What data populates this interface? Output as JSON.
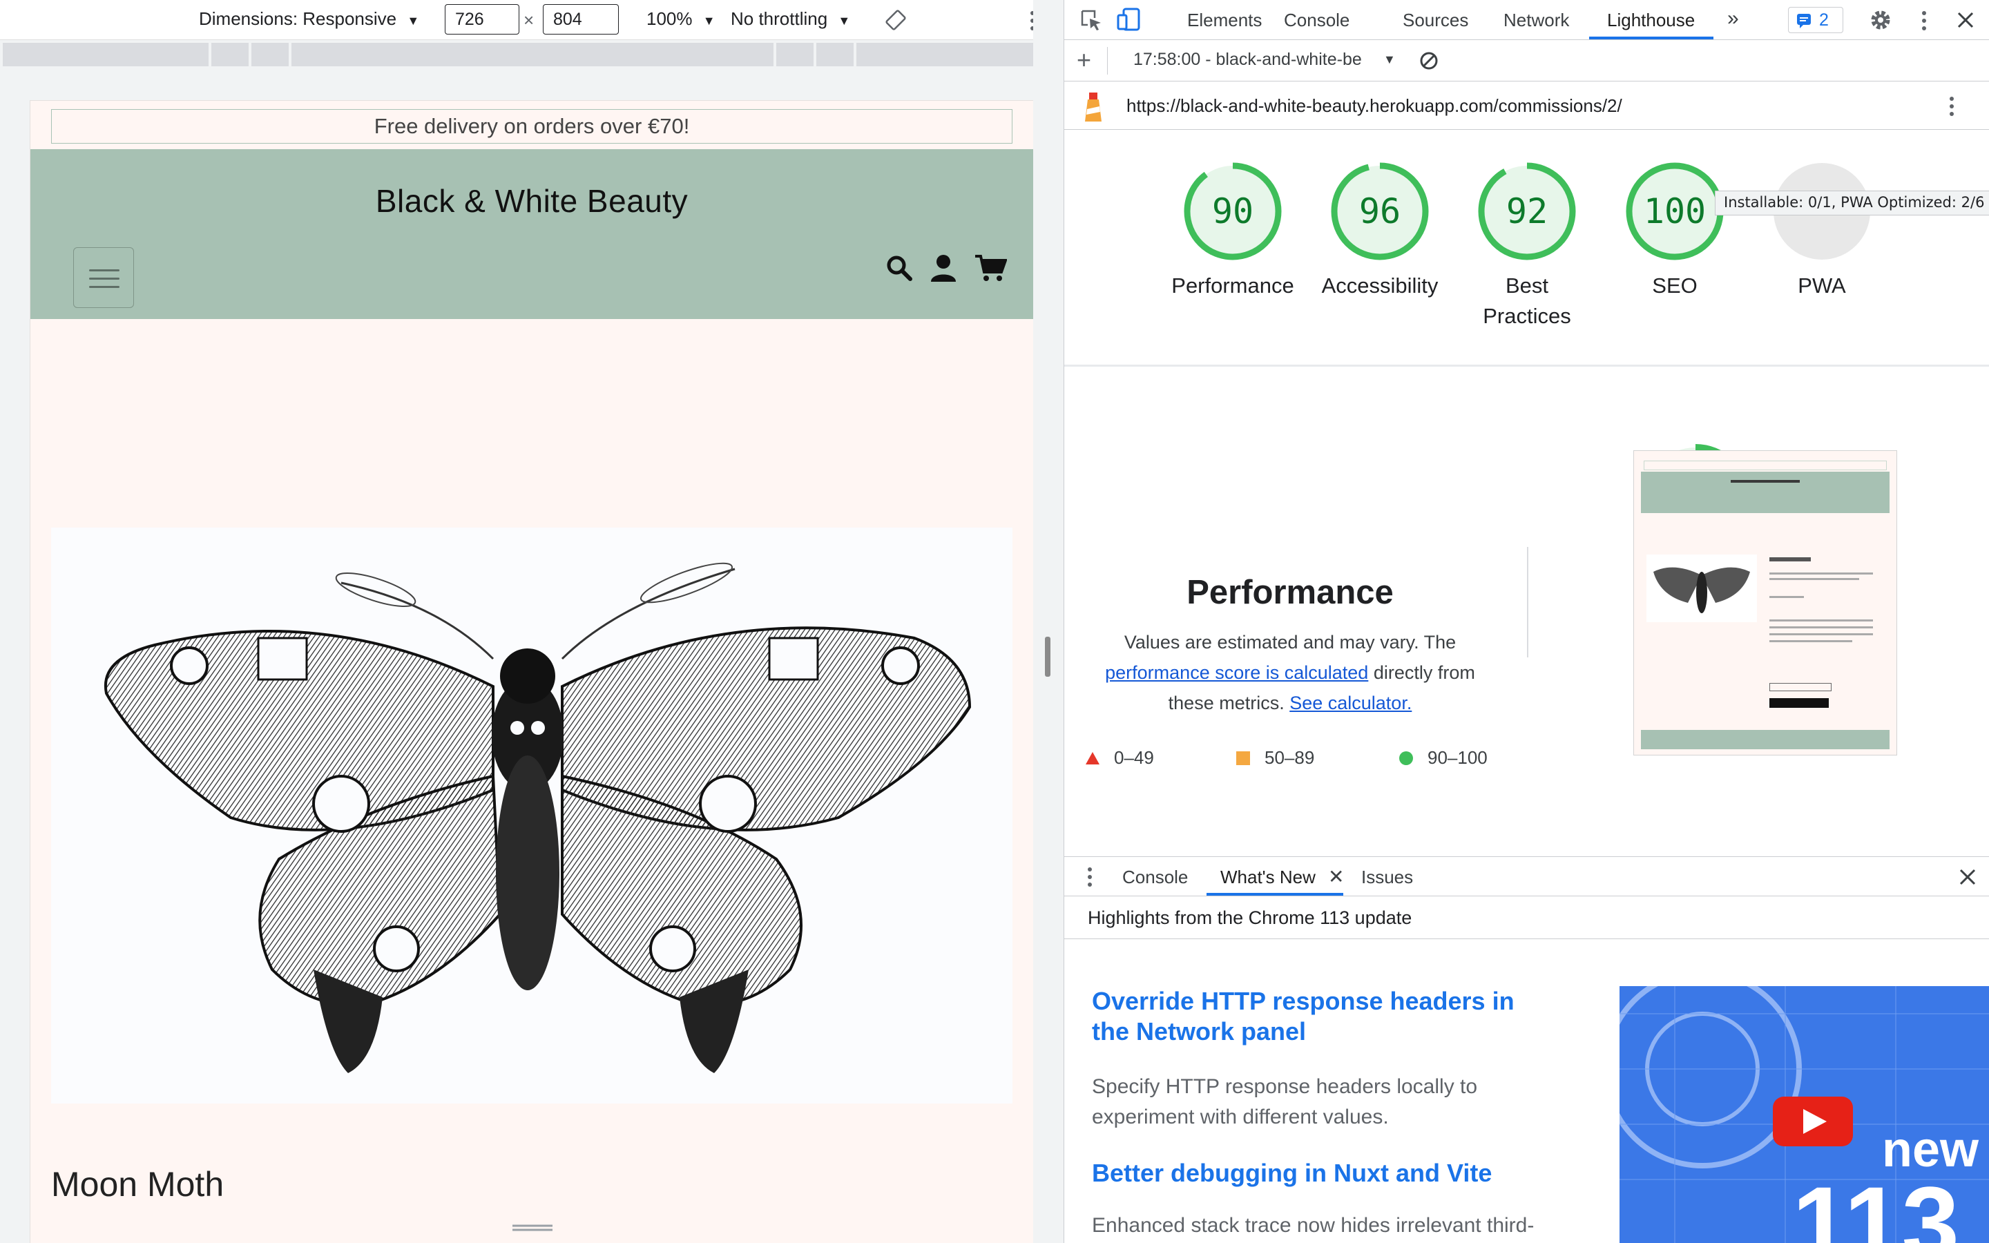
{
  "device_toolbar": {
    "dimensions_label": "Dimensions: Responsive",
    "width_value": "726",
    "times": "×",
    "height_value": "804",
    "zoom": "100%",
    "throttling": "No throttling"
  },
  "site": {
    "promo_banner": "Free delivery on orders over €70!",
    "title": "Black & White Beauty",
    "product_name": "Moon Moth"
  },
  "devtools": {
    "tabs": [
      "Elements",
      "Console",
      "Sources",
      "Network",
      "Lighthouse"
    ],
    "active_tab": "Lighthouse",
    "issues_count": "2",
    "report_label": "17:58:00 - black-and-white-be",
    "url": "https://black-and-white-beauty.herokuapp.com/commissions/2/"
  },
  "lighthouse": {
    "scores": [
      {
        "label": "Performance",
        "value": 90
      },
      {
        "label": "Accessibility",
        "value": 96
      },
      {
        "label": "Best Practices",
        "value": 92
      },
      {
        "label": "SEO",
        "value": 100
      }
    ],
    "pwa": {
      "label": "PWA",
      "tooltip": "Installable: 0/1, PWA Optimized: 2/6"
    },
    "performance": {
      "score": 90,
      "title": "Performance",
      "desc_prefix": "Values are estimated and may vary. The ",
      "desc_link1": "performance score is calculated",
      "desc_mid": " directly from these metrics. ",
      "desc_link2": "See calculator."
    },
    "legend": [
      {
        "range": "0–49",
        "color": "#e5372a"
      },
      {
        "range": "50–89",
        "color": "#f4a841"
      },
      {
        "range": "90–100",
        "color": "#3fbe5a"
      }
    ]
  },
  "drawer": {
    "tabs": [
      "Console",
      "What's New",
      "Issues"
    ],
    "active_tab": "What's New",
    "highlights": "Highlights from the Chrome 113 update",
    "items": [
      {
        "title": "Override HTTP response headers in the Network panel",
        "desc": "Specify HTTP response headers locally to experiment with different values."
      },
      {
        "title": "Better debugging in Nuxt and Vite",
        "desc": "Enhanced stack trace now hides irrelevant third-"
      }
    ],
    "promo_text": "new",
    "promo_number": "113"
  },
  "colors": {
    "header_green": "#a7c1b3",
    "page_bg": "#fff6f3",
    "score_green": "#0d7a2b",
    "link_blue": "#1a73e8"
  }
}
